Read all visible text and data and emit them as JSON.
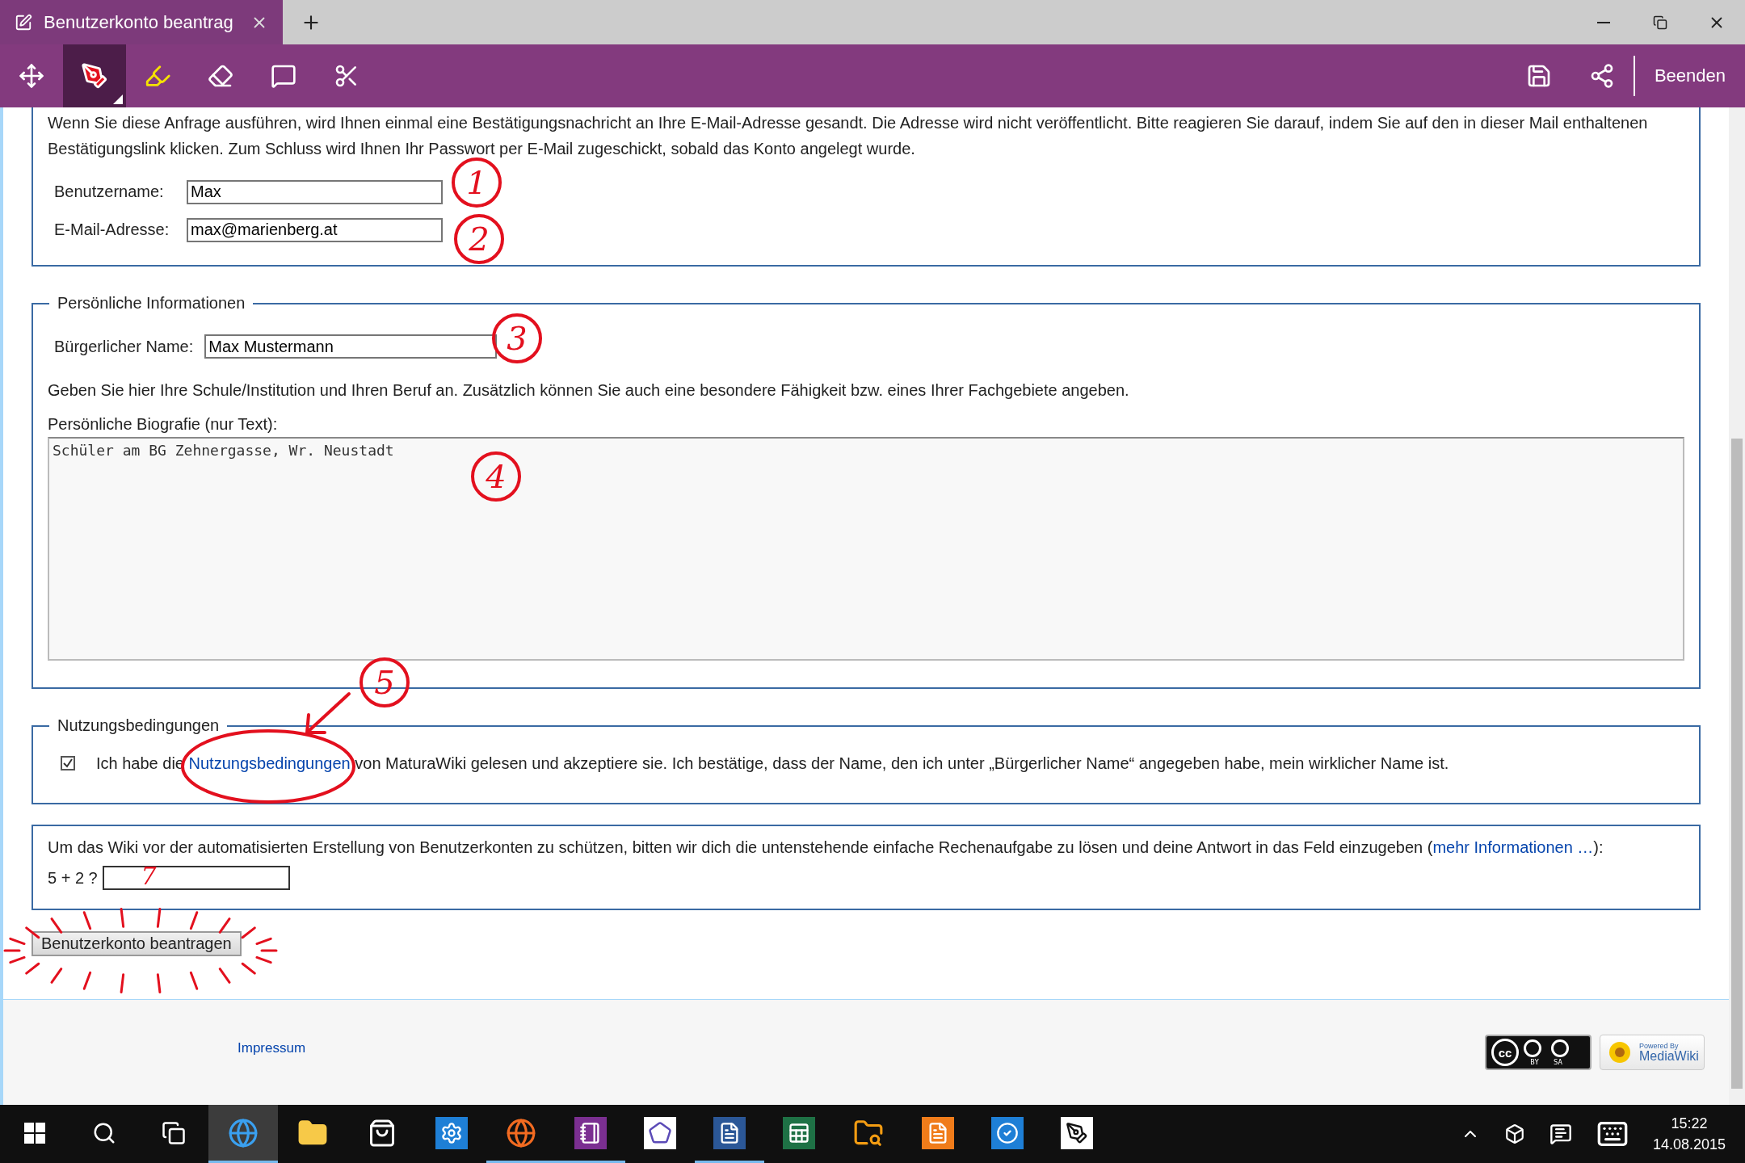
{
  "tab": {
    "title": "Benutzerkonto beantrag",
    "selected": true
  },
  "toolbar": {
    "tools": [
      {
        "kind": "pan",
        "selected": false
      },
      {
        "kind": "pen",
        "selected": true
      },
      {
        "kind": "highlighter",
        "selected": false
      },
      {
        "kind": "eraser",
        "selected": false
      },
      {
        "kind": "note",
        "selected": false
      },
      {
        "kind": "clip",
        "selected": false
      }
    ],
    "exit_label": "Beenden"
  },
  "intro": "Wenn Sie diese Anfrage ausführen, wird Ihnen einmal eine Bestätigungsnachricht an Ihre E-Mail-Adresse gesandt. Die Adresse wird nicht veröffentlicht. Bitte reagieren Sie darauf, indem Sie auf den in dieser Mail enthaltenen Bestätigungslink klicken. Zum Schluss wird Ihnen Ihr Passwort per E-Mail zugeschickt, sobald das Konto angelegt wurde.",
  "account_fields": [
    {
      "label": "Benutzername:",
      "value": "Max"
    },
    {
      "label": "E-Mail-Adresse:",
      "value": "max@marienberg.at"
    }
  ],
  "personal": {
    "legend": "Persönliche Informationen",
    "name_label": "Bürgerlicher Name:",
    "name_value": "Max Mustermann",
    "hint": "Geben Sie hier Ihre Schule/Institution und Ihren Beruf an. Zusätzlich können Sie auch eine besondere Fähigkeit bzw. eines Ihrer Fachgebiete angeben.",
    "bio_label": "Persönliche Biografie (nur Text):",
    "bio_value": "Schüler am BG Zehnergasse, Wr. Neustadt"
  },
  "terms": {
    "legend": "Nutzungsbedingungen",
    "checked": true,
    "text_before": "Ich habe die",
    "link": "Nutzungsbedingungen",
    "text_after": "von MaturaWiki gelesen und akzeptiere sie. Ich bestätige, dass der Name, den ich unter „Bürgerlicher Name“ angegeben habe, mein wirklicher Name ist."
  },
  "captcha": {
    "text_before": "Um das Wiki vor der automatisierten Erstellung von Benutzerkonten zu schützen, bitten wir dich die untenstehende einfache Rechenaufgabe zu lösen und deine Antwort in das Feld einzugeben (",
    "link": "mehr Informationen …",
    "text_after": "):",
    "question": "5 + 2 ?"
  },
  "submit": "Benutzerkonto beantragen",
  "annotations": [
    {
      "text": "1",
      "kind": "circled"
    },
    {
      "text": "2",
      "kind": "circled"
    },
    {
      "text": "3",
      "kind": "circled"
    },
    {
      "text": "4",
      "kind": "circled"
    },
    {
      "text": "5",
      "kind": "circled"
    },
    {
      "text": "7",
      "kind": "plain"
    }
  ],
  "footer": {
    "link": "Impressum",
    "license_badge": {
      "mark": "cc",
      "labels": [
        "BY",
        "SA"
      ]
    },
    "powered_badge": {
      "line1": "Powered By",
      "line2": "MediaWiki"
    }
  },
  "taskbar": {
    "apps": [
      {
        "kind": "edge",
        "selected": true,
        "running": true
      },
      {
        "kind": "explorer",
        "selected": false,
        "running": false
      },
      {
        "kind": "store",
        "selected": false,
        "running": false
      },
      {
        "kind": "settings",
        "selected": false,
        "running": false
      },
      {
        "kind": "firefox",
        "selected": false,
        "running": true
      },
      {
        "kind": "onenote",
        "selected": false,
        "running": true
      },
      {
        "kind": "geometry",
        "selected": false,
        "running": false
      },
      {
        "kind": "word",
        "selected": false,
        "running": true
      },
      {
        "kind": "excel",
        "selected": false,
        "running": false
      },
      {
        "kind": "search-folder",
        "selected": false,
        "running": false
      },
      {
        "kind": "pdf",
        "selected": false,
        "running": false
      },
      {
        "kind": "todo",
        "selected": false,
        "running": false
      },
      {
        "kind": "webnote",
        "selected": false,
        "running": false
      }
    ],
    "time": "15:22",
    "date": "14.08.2015"
  }
}
